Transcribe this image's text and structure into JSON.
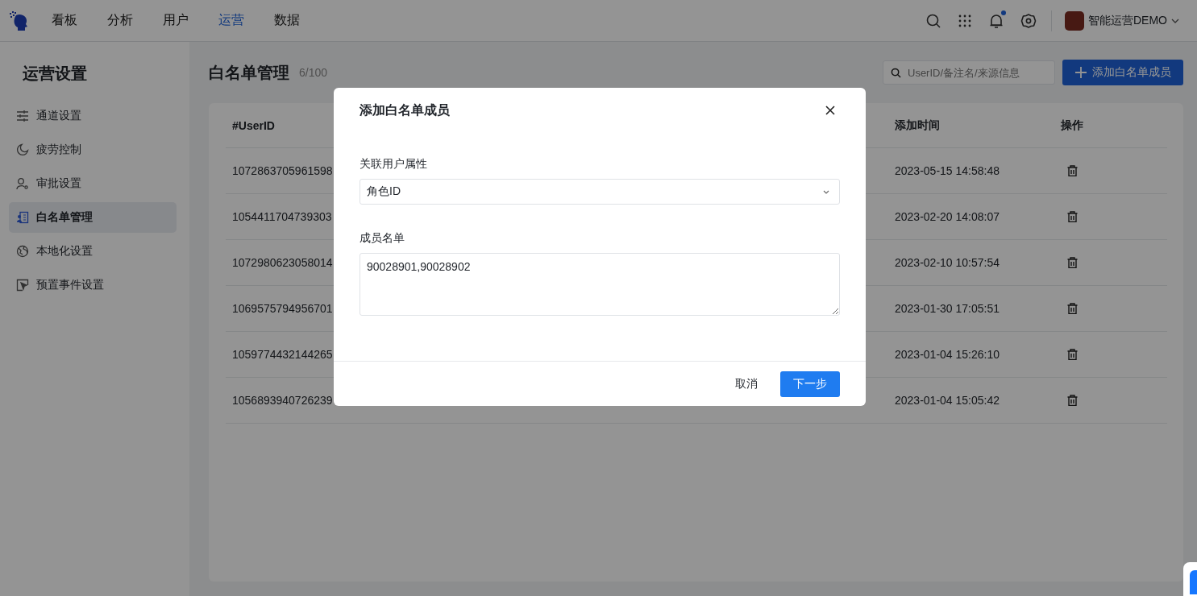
{
  "topbar": {
    "nav": [
      {
        "label": "看板",
        "selected": false
      },
      {
        "label": "分析",
        "selected": false
      },
      {
        "label": "用户",
        "selected": false
      },
      {
        "label": "运营",
        "selected": true
      },
      {
        "label": "数据",
        "selected": false
      }
    ],
    "has_unread": true,
    "account": "智能运营DEMO"
  },
  "sidebar": {
    "title": "运营设置",
    "items": [
      {
        "label": "通道设置",
        "selected": false
      },
      {
        "label": "疲劳控制",
        "selected": false
      },
      {
        "label": "审批设置",
        "selected": false
      },
      {
        "label": "白名单管理",
        "selected": true
      },
      {
        "label": "本地化设置",
        "selected": false
      },
      {
        "label": "预置事件设置",
        "selected": false
      }
    ]
  },
  "page": {
    "title": "白名单管理",
    "count": "6/100",
    "search": {
      "placeholder": "UserID/备注名/来源信息"
    },
    "add_button": "添加白名单成员"
  },
  "table": {
    "columns": [
      "#UserID",
      "添加时间",
      "操作"
    ],
    "rows": [
      {
        "user_id": "1072863705961598",
        "added_time": "2023-05-15 14:58:48"
      },
      {
        "user_id": "1054411704739303",
        "added_time": "2023-02-20 14:08:07"
      },
      {
        "user_id": "1072980623058014",
        "added_time": "2023-02-10 10:57:54"
      },
      {
        "user_id": "1069575794956701",
        "added_time": "2023-01-30 17:05:51"
      },
      {
        "user_id": "1059774432144265",
        "added_time": "2023-01-04 15:26:10"
      },
      {
        "user_id": "1056893940726239",
        "added_time": "2023-01-04 15:05:42"
      }
    ]
  },
  "dialog": {
    "title": "添加白名单成员",
    "attribute": {
      "label": "关联用户属性",
      "value": "角色ID"
    },
    "members": {
      "label": "成员名单",
      "value": "90028901,90028902"
    },
    "buttons": {
      "cancel": "取消",
      "next": "下一步"
    }
  }
}
